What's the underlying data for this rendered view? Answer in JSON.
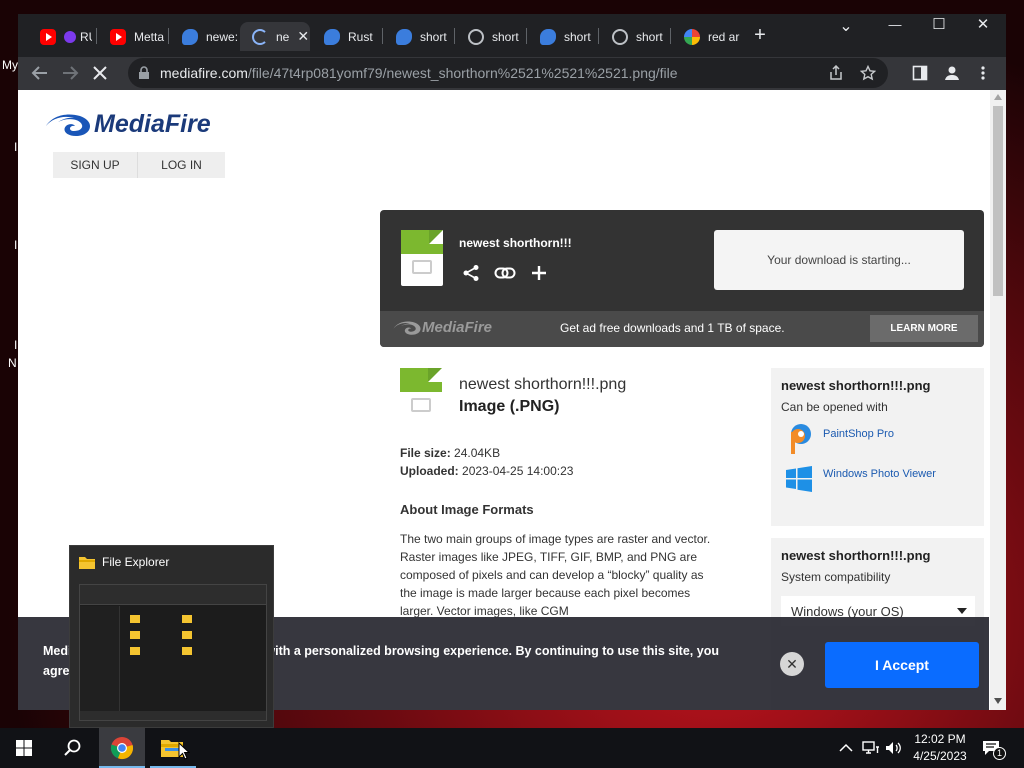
{
  "desktop": {
    "fragments": [
      "My",
      "I",
      "I",
      "I",
      "N"
    ]
  },
  "browser": {
    "tabs": [
      {
        "icon": "youtube-icon",
        "label": "RU"
      },
      {
        "icon": "youtube-icon",
        "label": "Metta"
      },
      {
        "icon": "mediafire-icon",
        "label": "newe:"
      },
      {
        "icon": "loading-icon",
        "label": "ne",
        "active": true
      },
      {
        "icon": "mediafire-icon",
        "label": "Rust"
      },
      {
        "icon": "mediafire-icon",
        "label": "short"
      },
      {
        "icon": "globe-icon",
        "label": "short"
      },
      {
        "icon": "mediafire-icon",
        "label": "short"
      },
      {
        "icon": "globe-icon",
        "label": "short"
      },
      {
        "icon": "google-icon",
        "label": "red ar"
      }
    ],
    "new_tab": "+",
    "window_controls": {
      "dropdown": "⌄",
      "minimize": "—",
      "maximize": "☐",
      "close": "✕"
    },
    "url": {
      "host": "mediafire.com",
      "path": "/file/47t4rp081yomf79/newest_shorthorn%2521%2521%2521.png/file"
    }
  },
  "page": {
    "logo_text": "MediaFire",
    "nav": {
      "sign_up": "SIGN UP",
      "log_in": "LOG IN"
    },
    "download_card": {
      "file_name": "newest shorthorn!!!",
      "status": "Your download is starting...",
      "brand": "MediaFire",
      "promo": "Get ad free downloads and 1 TB of space.",
      "learn_more": "LEARN MORE"
    },
    "file_info": {
      "name": "newest shorthorn!!!.png",
      "type": "Image (.PNG)",
      "size_label": "File size:",
      "size_value": "24.04KB",
      "uploaded_label": "Uploaded:",
      "uploaded_value": "2023-04-25 14:00:23"
    },
    "about": {
      "heading": "About Image Formats",
      "body": "The two main groups of image types are raster and vector. Raster images like JPEG, TIFF, GIF, BMP, and PNG are composed of pixels and can develop a “blocky” quality as the image is made larger because each pixel becomes larger. Vector images, like CGM"
    },
    "open_with": {
      "title": "newest shorthorn!!!.png",
      "subtitle": "Can be opened with",
      "apps": [
        "PaintShop Pro",
        "Windows Photo Viewer"
      ]
    },
    "compat": {
      "title": "newest shorthorn!!!.png",
      "subtitle": "System compatibility",
      "select": "Windows (your OS)"
    }
  },
  "cookie_banner": {
    "text_left": "Media",
    "text_left2": "agree",
    "text_right": "with a personalized browsing experience. By continuing to use this site, you",
    "accept": "I Accept",
    "close": "✕"
  },
  "explorer_preview": {
    "title": "File Explorer"
  },
  "taskbar": {
    "time": "12:02 PM",
    "date": "4/25/2023",
    "notification_count": "1"
  }
}
